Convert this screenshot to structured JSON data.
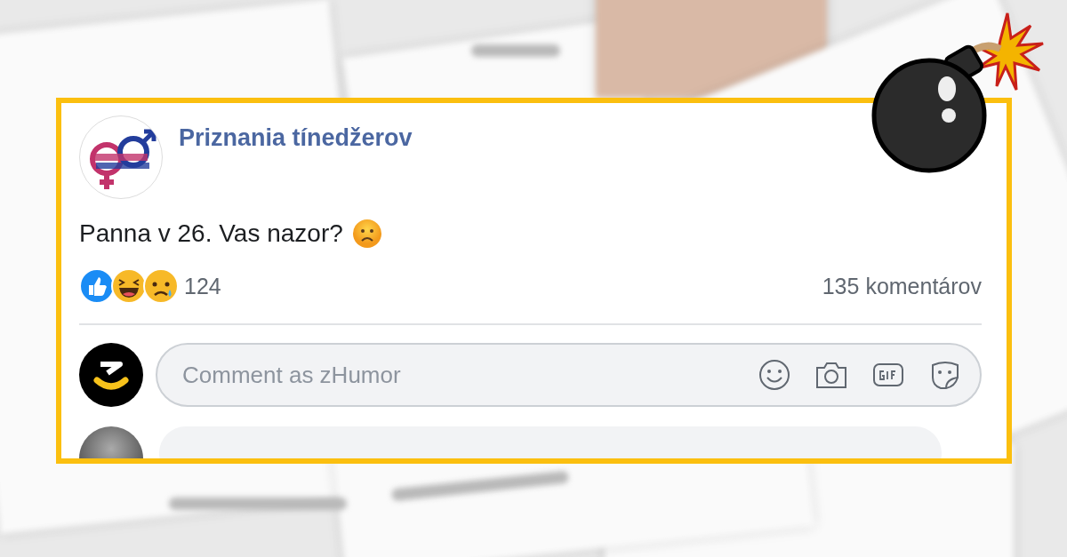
{
  "post": {
    "page_name": "Priznania tínedžerov",
    "text": "Panna v 26. Vas nazor?",
    "reaction_count": "124",
    "comments_count": "135 komentárov",
    "comment_field": {
      "placeholder": "Comment as zHumor"
    }
  }
}
